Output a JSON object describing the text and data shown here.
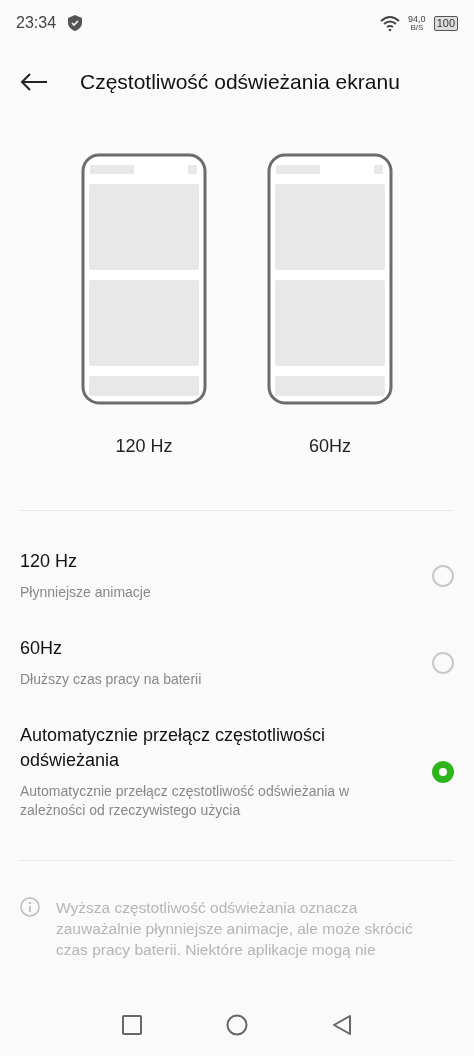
{
  "status_bar": {
    "time": "23:34",
    "speed_value": "94,0",
    "speed_unit": "B/S",
    "battery": "100"
  },
  "header": {
    "title": "Częstotliwość odświeżania ekranu"
  },
  "previews": [
    {
      "label": "120 Hz"
    },
    {
      "label": "60Hz"
    }
  ],
  "options": [
    {
      "title": "120 Hz",
      "subtitle": "Płynniejsze animacje",
      "selected": false
    },
    {
      "title": "60Hz",
      "subtitle": "Dłuższy czas pracy na baterii",
      "selected": false
    },
    {
      "title": "Automatycznie przełącz częstotliwości odświeżania",
      "subtitle": "Automatycznie przełącz częstotliwość odświeżania w zależności od rzeczywistego użycia",
      "selected": true
    }
  ],
  "note": "Wyższa częstotliwość odświeżania oznacza zauważalnie płynniejsze animacje, ale może skrócić czas pracy baterii. Niektóre aplikacje mogą nie"
}
